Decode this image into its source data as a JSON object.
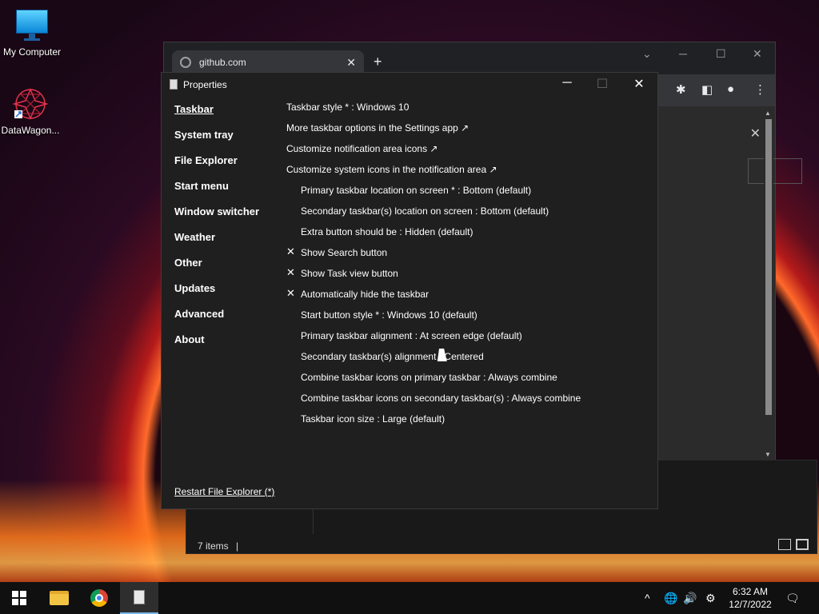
{
  "desktop": {
    "icons": [
      {
        "label": "My Computer"
      },
      {
        "label": "DataWagon..."
      }
    ]
  },
  "browser": {
    "tab_title": "github.com",
    "new_tab": "+",
    "close_tab": "✕",
    "minimize": "─",
    "maximize": "☐",
    "close": "✕",
    "dropdown": "⌄"
  },
  "explorer": {
    "status": "7 items"
  },
  "properties": {
    "title": "Properties",
    "nav": [
      {
        "label": "Taskbar",
        "active": true
      },
      {
        "label": "System tray"
      },
      {
        "label": "File Explorer"
      },
      {
        "label": "Start menu"
      },
      {
        "label": "Window switcher"
      },
      {
        "label": "Weather"
      },
      {
        "label": "Other"
      },
      {
        "label": "Updates"
      },
      {
        "label": "Advanced"
      },
      {
        "label": "About"
      }
    ],
    "options": [
      {
        "text": "Taskbar style * : Windows 10",
        "indent": false,
        "mark": ""
      },
      {
        "text": "More taskbar options in the Settings app ↗",
        "indent": false,
        "mark": ""
      },
      {
        "text": "Customize notification area icons ↗",
        "indent": false,
        "mark": ""
      },
      {
        "text": "Customize system icons in the notification area ↗",
        "indent": false,
        "mark": ""
      },
      {
        "text": "Primary taskbar location on screen * : Bottom (default)",
        "indent": true,
        "mark": ""
      },
      {
        "text": "Secondary taskbar(s) location on screen : Bottom (default)",
        "indent": true,
        "mark": ""
      },
      {
        "text": "Extra button should be : Hidden (default)",
        "indent": true,
        "mark": ""
      },
      {
        "text": "Show Search button",
        "indent": true,
        "mark": "✕"
      },
      {
        "text": "Show Task view button",
        "indent": true,
        "mark": "✕"
      },
      {
        "text": "Automatically hide the taskbar",
        "indent": true,
        "mark": "✕"
      },
      {
        "text": "Start button style * : Windows 10 (default)",
        "indent": true,
        "mark": ""
      },
      {
        "text": "Primary taskbar alignment : At screen edge (default)",
        "indent": true,
        "mark": ""
      },
      {
        "text": "Secondary taskbar(s) alignment : Centered",
        "indent": true,
        "mark": ""
      },
      {
        "text": "Combine taskbar icons on primary taskbar : Always combine",
        "indent": true,
        "mark": ""
      },
      {
        "text": "Combine taskbar icons on secondary taskbar(s) : Always combine",
        "indent": true,
        "mark": ""
      },
      {
        "text": "Taskbar icon size : Large (default)",
        "indent": true,
        "mark": ""
      }
    ],
    "restart_link": "Restart File Explorer (*)",
    "minimize": "─",
    "maximize": "☐",
    "close": "✕"
  },
  "taskbar": {
    "time": "6:32 AM",
    "date": "12/7/2022",
    "tray": {
      "chevron": "^",
      "network": "🌐",
      "volume": "🔊",
      "settings": "⚙",
      "notifications": "🗨"
    }
  }
}
